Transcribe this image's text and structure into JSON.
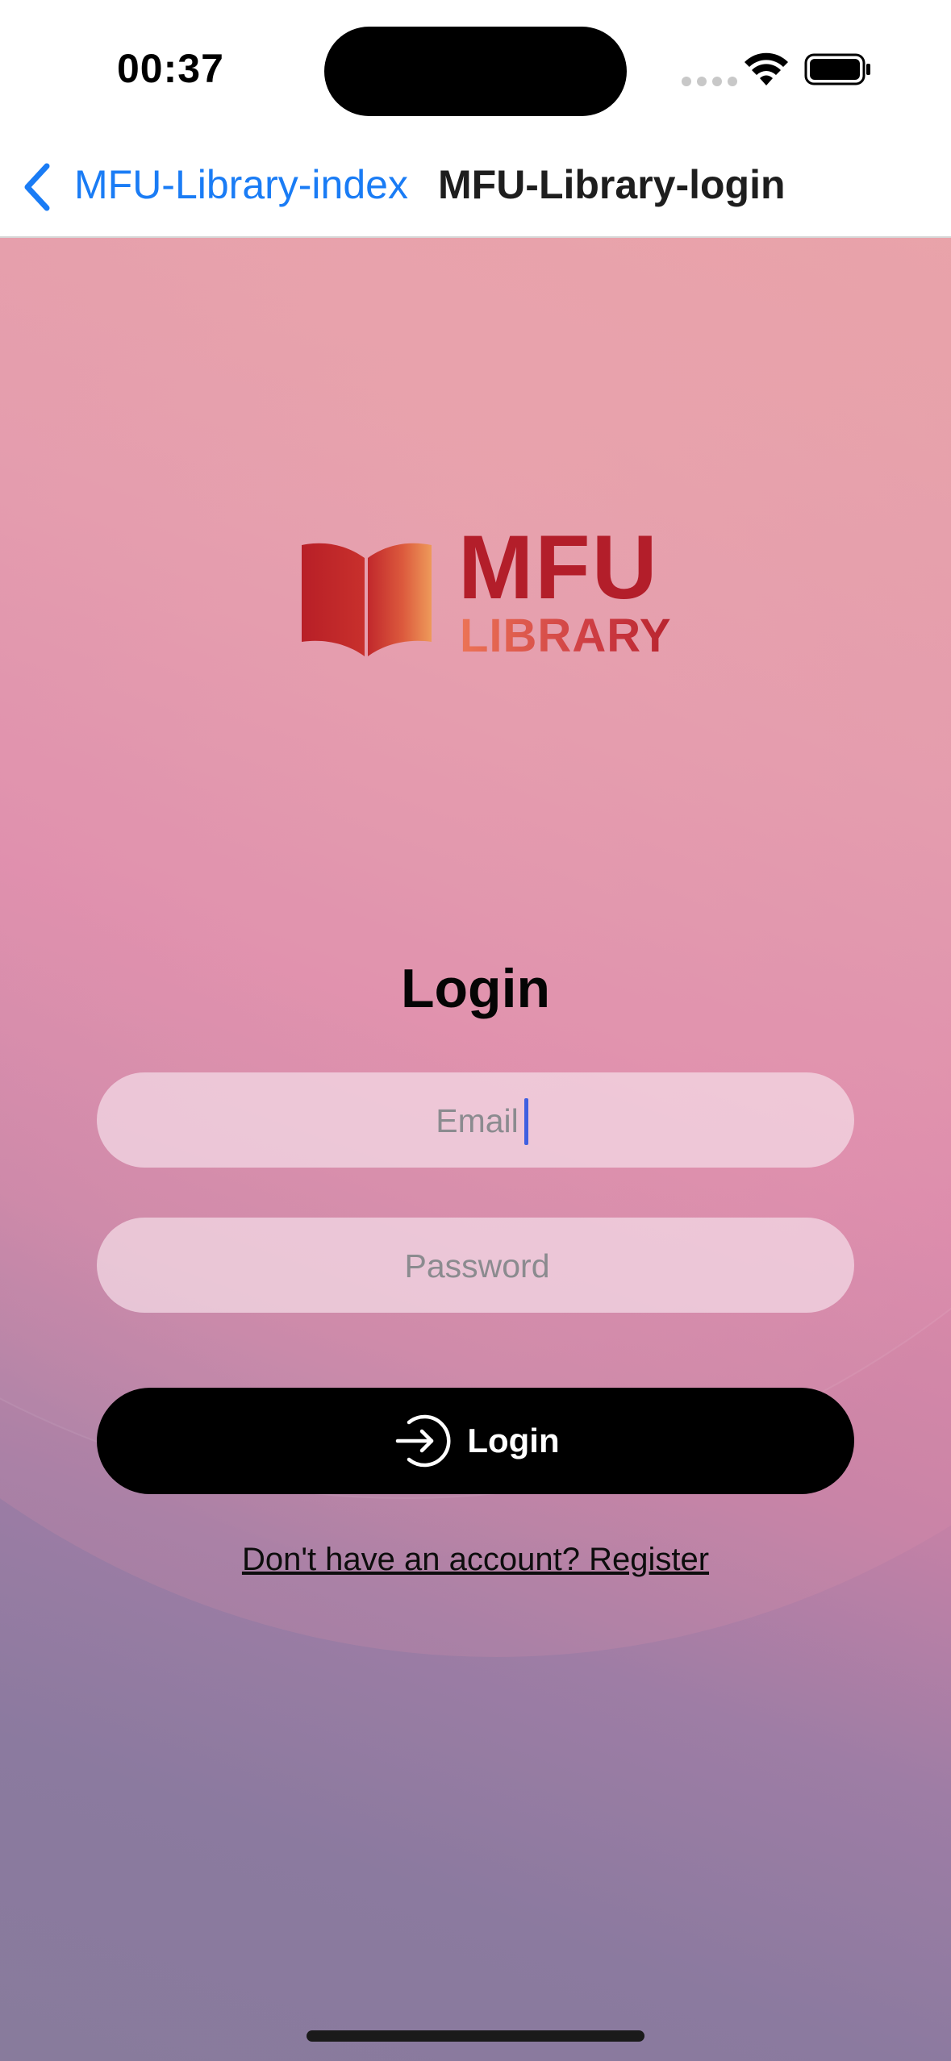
{
  "status_bar": {
    "time": "00:37"
  },
  "nav_bar": {
    "back_label": "MFU-Library-index",
    "title": "MFU-Library-login"
  },
  "logo": {
    "text_main": "MFU",
    "text_sub": "LIBRARY",
    "colors": {
      "primary": "#b31e2a",
      "accent": "#ec7456"
    }
  },
  "login_form": {
    "heading": "Login",
    "email_placeholder": "Email",
    "password_placeholder": "Password",
    "submit_label": "Login",
    "submit_icon": "login-arrow-icon",
    "register_link": "Don't have an account? Register"
  },
  "colors": {
    "link_blue": "#1a7cf5",
    "button_bg": "#000000"
  }
}
